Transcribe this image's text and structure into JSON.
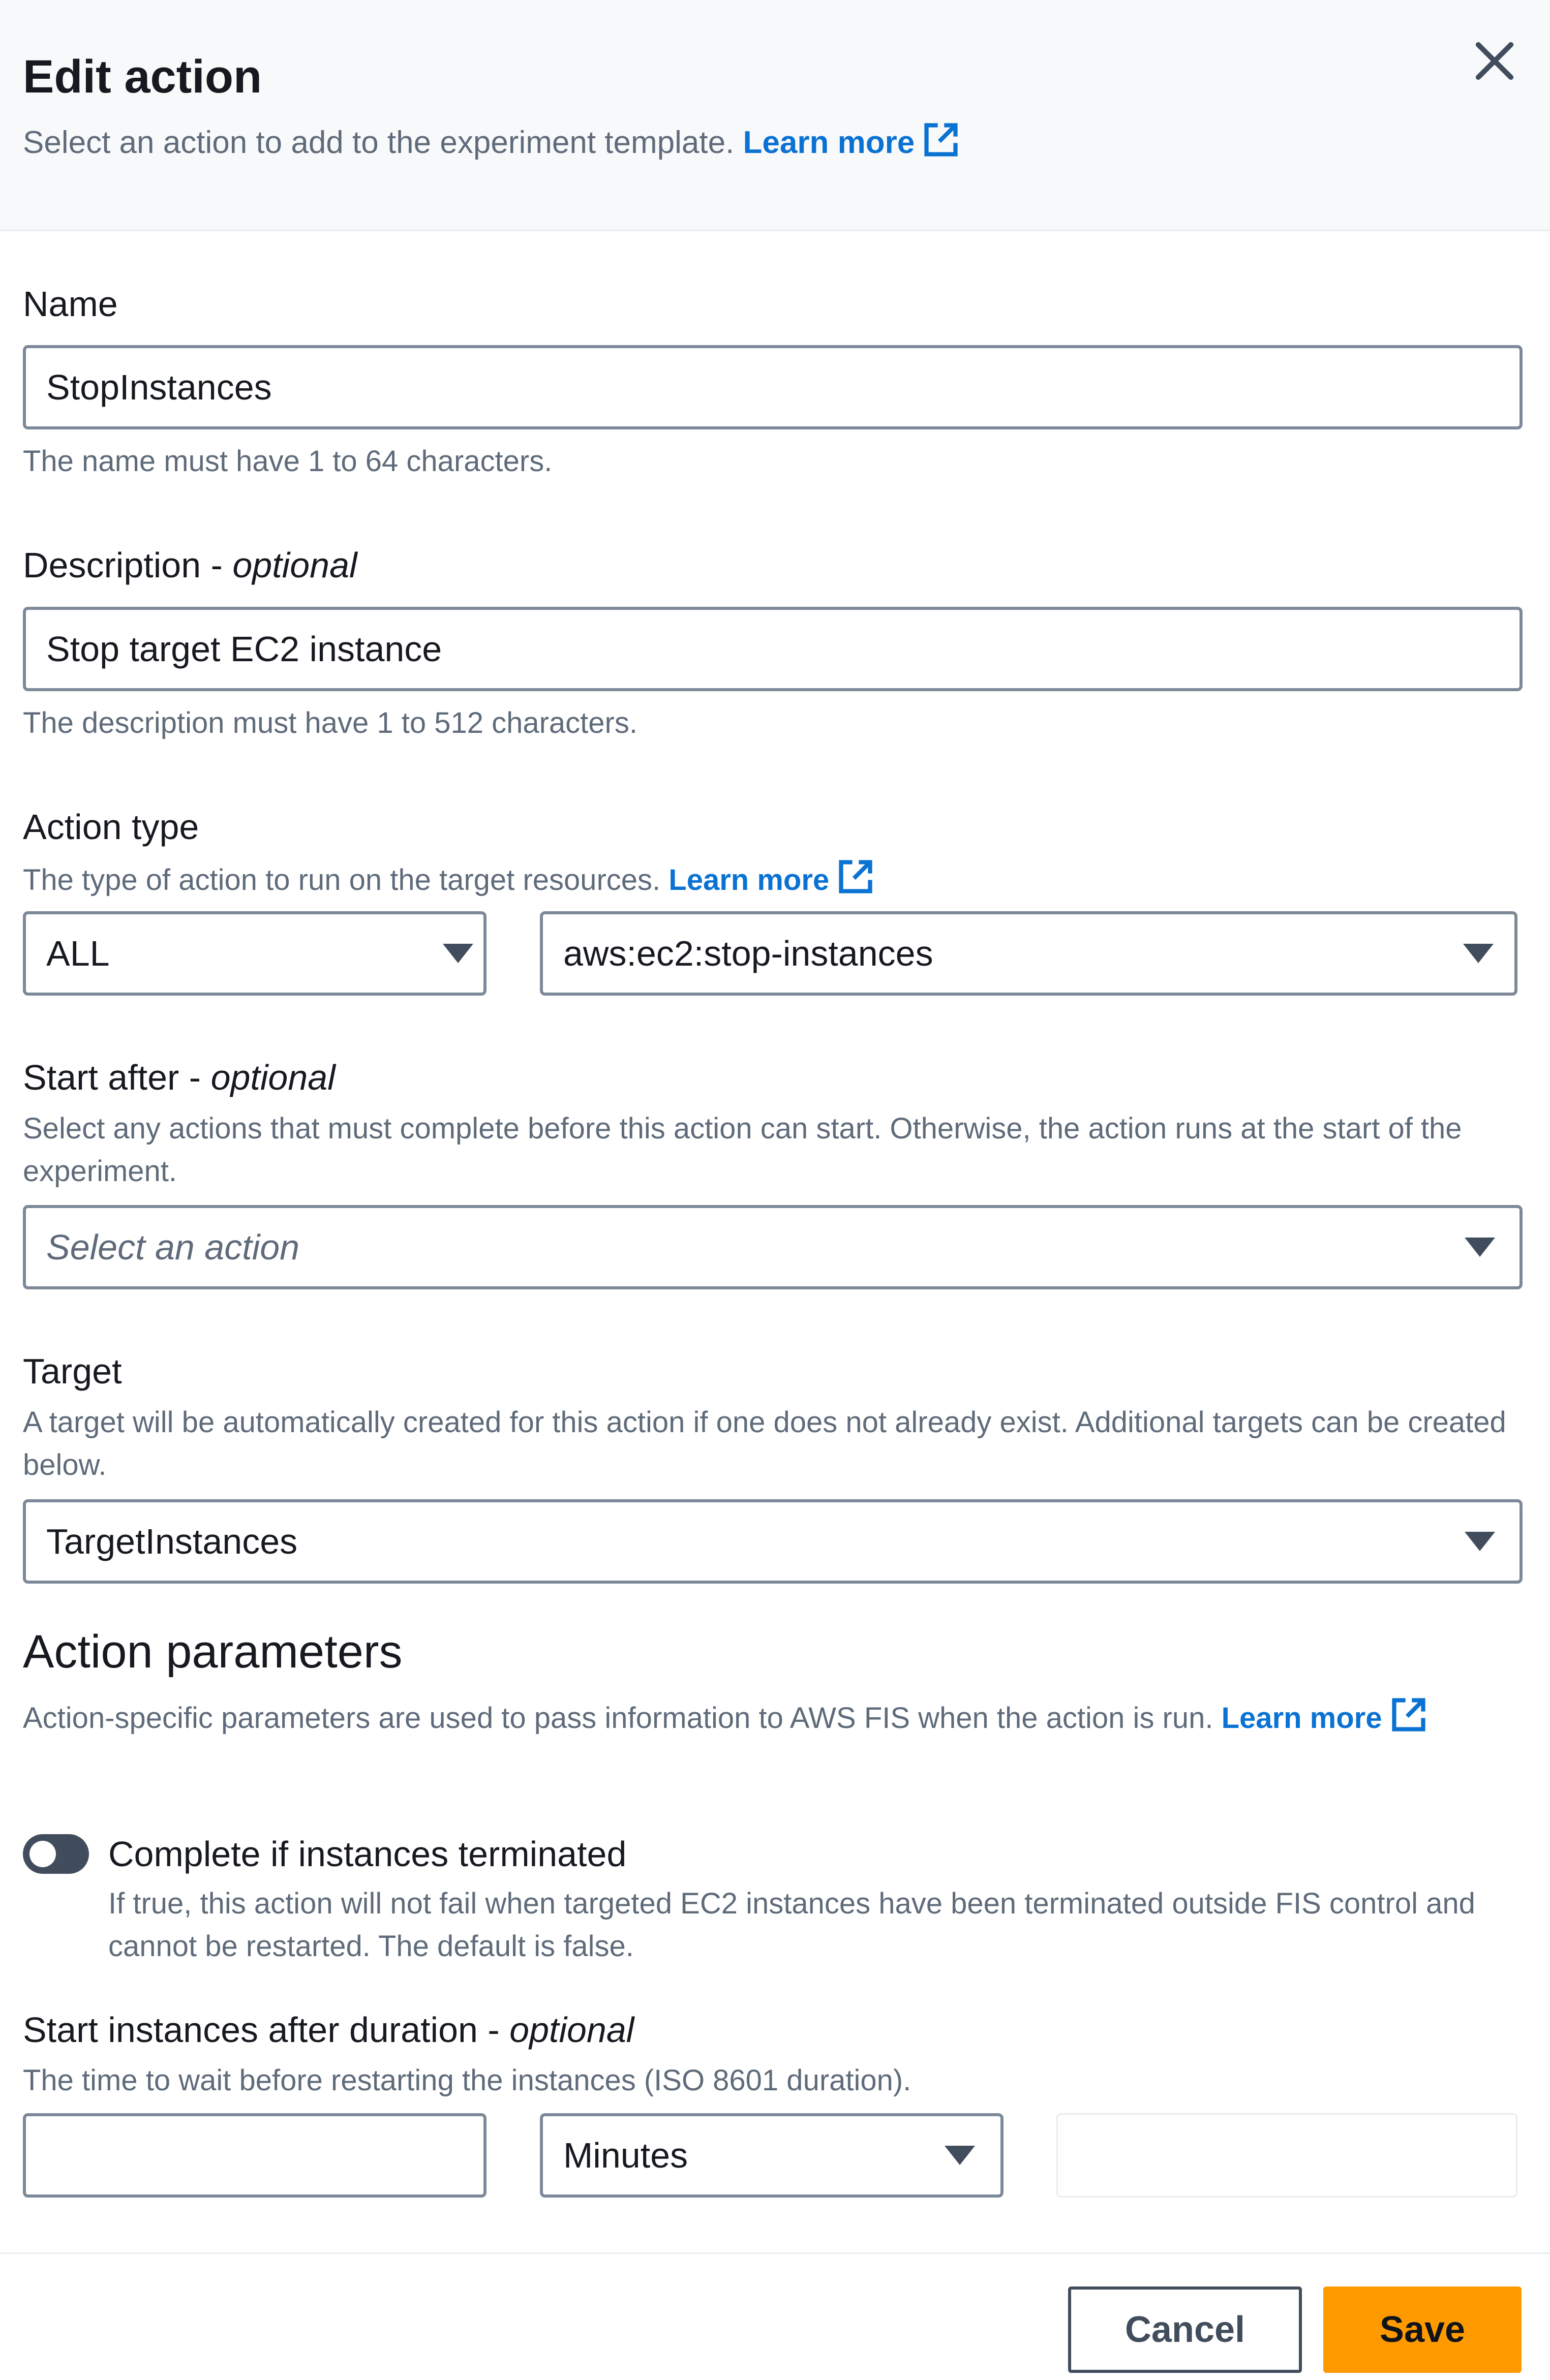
{
  "header": {
    "title": "Edit action",
    "subtitle": "Select an action to add to the experiment template.",
    "learn_more": "Learn more",
    "close_icon": "close-icon",
    "external_icon": "external-link-icon"
  },
  "name": {
    "label": "Name",
    "value": "StopInstances",
    "hint": "The name must have 1 to 64 characters."
  },
  "description": {
    "label": "Description - ",
    "optional": "optional",
    "value": "Stop target EC2 instance",
    "hint": "The description must have 1 to 512 characters."
  },
  "action_type": {
    "label": "Action type",
    "hint": "The type of action to run on the target resources.",
    "learn_more": "Learn more",
    "filter_value": "ALL",
    "action_value": "aws:ec2:stop-instances"
  },
  "start_after": {
    "label": "Start after - ",
    "optional": "optional",
    "hint": "Select any actions that must complete before this action can start. Otherwise, the action runs at the start of the experiment.",
    "placeholder": "Select an action"
  },
  "target": {
    "label": "Target",
    "hint": "A target will be automatically created for this action if one does not already exist. Additional targets can be created below.",
    "value": "TargetInstances"
  },
  "action_parameters": {
    "title": "Action parameters",
    "hint": "Action-specific parameters are used to pass information to AWS FIS when the action is run.",
    "learn_more": "Learn more",
    "toggle": {
      "label": "Complete if instances terminated",
      "description": "If true, this action will not fail when targeted EC2 instances have been terminated outside FIS control and cannot be restarted. The default is false.",
      "checked": false
    },
    "duration": {
      "label": "Start instances after duration - ",
      "optional": "optional",
      "hint": "The time to wait before restarting the instances (ISO 8601 duration).",
      "value": "",
      "unit": "Minutes",
      "iso_value": ""
    }
  },
  "footer": {
    "cancel": "Cancel",
    "save": "Save"
  },
  "colors": {
    "link": "#0972d3",
    "primary": "#ff9900",
    "border": "#7d8998",
    "muted_text": "#5f6b7a",
    "header_bg": "#f8f9fa"
  }
}
